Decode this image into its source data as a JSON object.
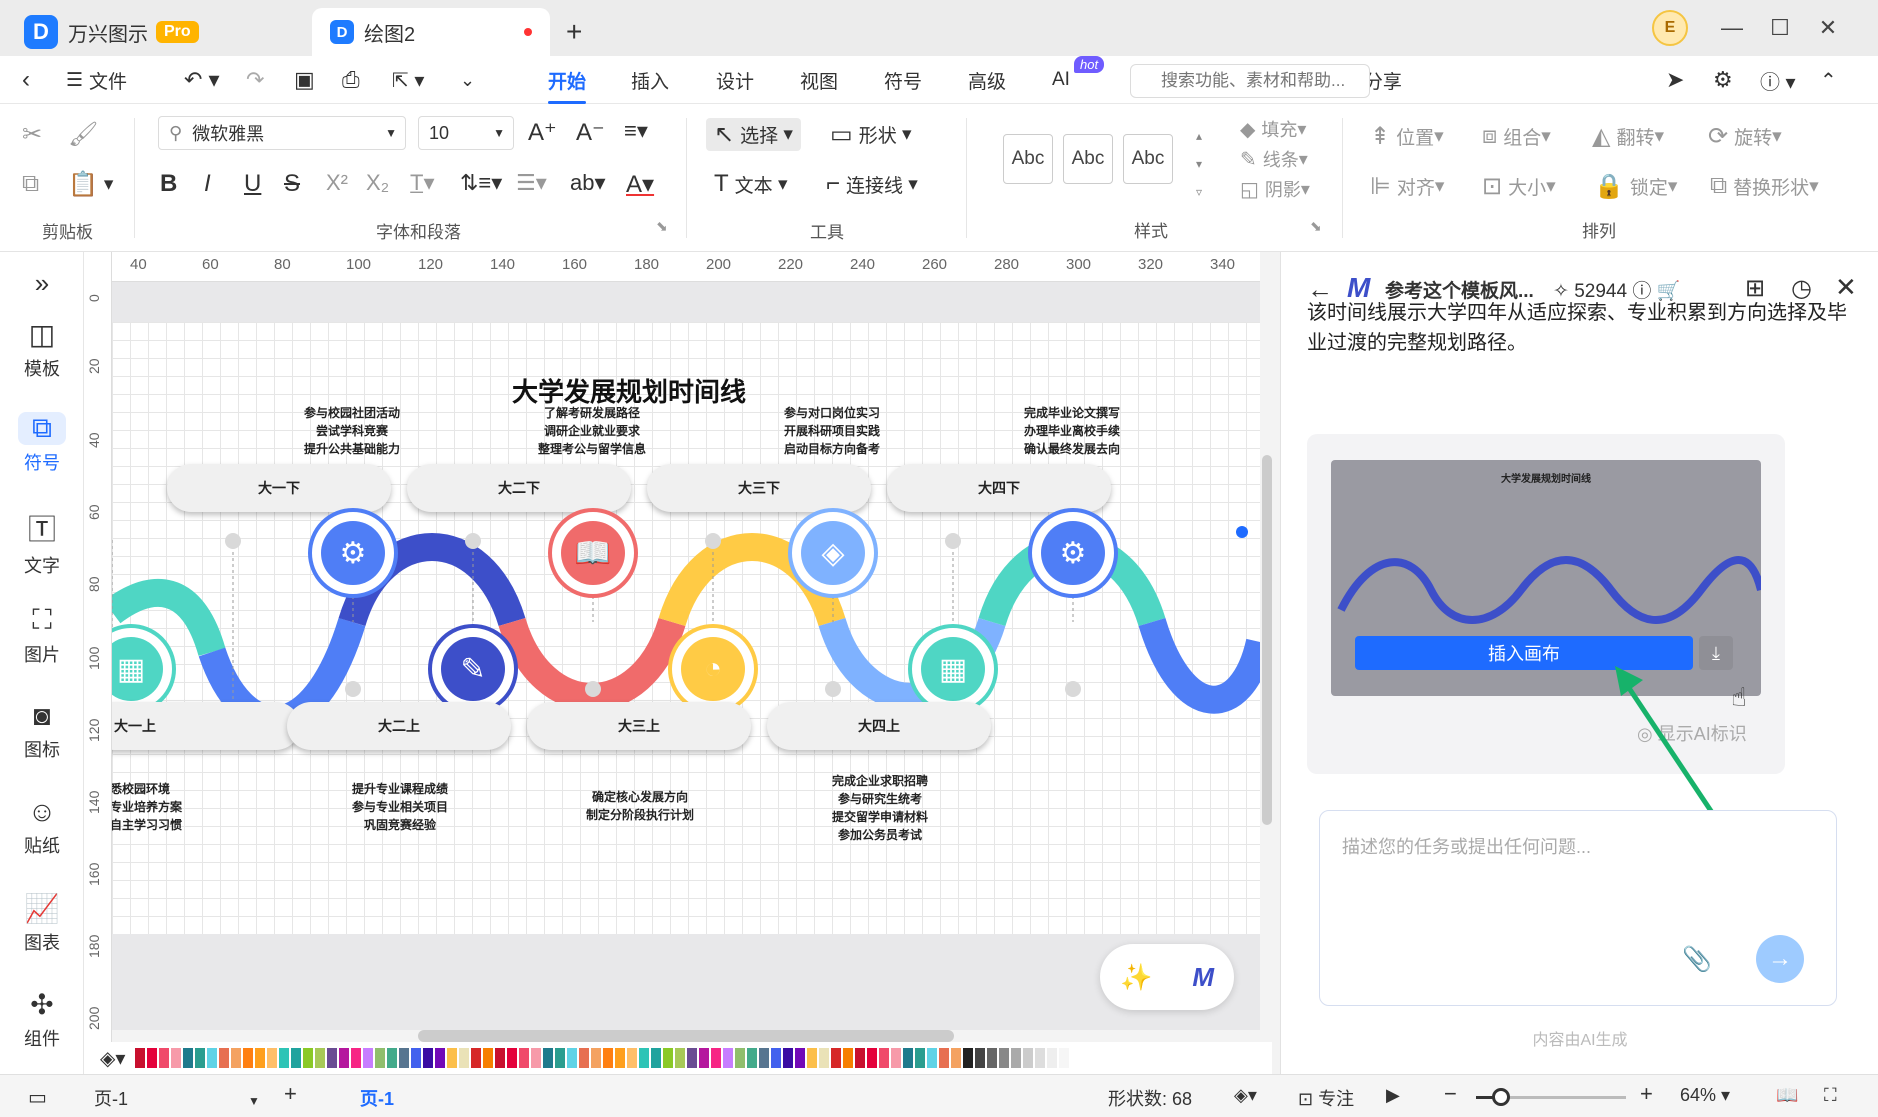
{
  "titlebar": {
    "app_name": "万兴图示",
    "pro_badge": "Pro",
    "doc_tab": "绘图2",
    "new_tab": "+",
    "avatar_letter": "E"
  },
  "menubar": {
    "file": "文件",
    "tabs": [
      "开始",
      "插入",
      "设计",
      "视图",
      "符号",
      "高级",
      "AI"
    ],
    "hot_badge": "hot",
    "search_placeholder": "搜索功能、素材和帮助...",
    "export": "导出",
    "share": "分享"
  },
  "ribbon": {
    "font_name": "微软雅黑",
    "font_size": "10",
    "select": "选择",
    "shape": "形状",
    "text": "文本",
    "connector": "连接线",
    "abc": "Abc",
    "fill": "填充",
    "line": "线条",
    "shadow": "阴影",
    "position": "位置",
    "group": "组合",
    "flip": "翻转",
    "rotate": "旋转",
    "align": "对齐",
    "size": "大小",
    "lock": "锁定",
    "replace_shape": "替换形状",
    "groups": [
      "剪贴板",
      "字体和段落",
      "工具",
      "样式",
      "排列"
    ]
  },
  "leftbar": {
    "items": [
      "模板",
      "符号",
      "文字",
      "图片",
      "图标",
      "贴纸",
      "图表",
      "组件"
    ]
  },
  "ruler": {
    "top": [
      "40",
      "60",
      "80",
      "100",
      "120",
      "140",
      "160",
      "180",
      "200",
      "220",
      "240",
      "260",
      "280",
      "300",
      "320",
      "340"
    ],
    "left": [
      "0",
      "20",
      "40",
      "60",
      "80",
      "100",
      "120",
      "140",
      "160",
      "180",
      "200"
    ]
  },
  "diagram": {
    "title": "大学发展规划时间线",
    "top_pills": [
      "大一下",
      "大二下",
      "大三下",
      "大四下"
    ],
    "bottom_pills": [
      "大一上",
      "大二上",
      "大三上",
      "大四上"
    ],
    "top_notes": [
      [
        "参与校园社团活动",
        "尝试学科竞赛",
        "提升公共基础能力"
      ],
      [
        "了解考研发展路径",
        "调研企业就业要求",
        "整理考公与留学信息"
      ],
      [
        "参与对口岗位实习",
        "开展科研项目实践",
        "启动目标方向备考"
      ],
      [
        "完成毕业论文撰写",
        "办理毕业离校手续",
        "确认最终发展去向"
      ]
    ],
    "bottom_notes": [
      [
        "悉校园环境",
        "专业培养方案",
        "自主学习习惯"
      ],
      [
        "提升专业课程成绩",
        "参与专业相关项目",
        "巩固竞赛经验"
      ],
      [
        "确定核心发展方向",
        "制定分阶段执行计划"
      ],
      [
        "完成企业求职招聘",
        "参与研究生统考",
        "提交留学申请材料",
        "参加公务员考试"
      ]
    ],
    "colors": {
      "teal": "#4fd6c4",
      "indigo": "#3d4fc9",
      "blue": "#4f7ef6",
      "red": "#f06b6b",
      "yellow": "#ffcb45",
      "lightblue": "#7fb2ff"
    }
  },
  "panel": {
    "title": "参考这个模板风...",
    "credits": "52944",
    "description": "该时间线展示大学四年从适应探索、专业积累到方向选择及毕业过渡的完整规划路径。",
    "thumb_title": "大学发展规划时间线",
    "insert_button": "插入画布",
    "show_ai_label": "显示AI标识",
    "input_placeholder": "描述您的任务或提出任何问题...",
    "footer": "内容由AI生成"
  },
  "statusbar": {
    "page_select": "页-1",
    "page_tab": "页-1",
    "shape_count": "形状数: 68",
    "focus": "专注",
    "zoom": "64%"
  }
}
